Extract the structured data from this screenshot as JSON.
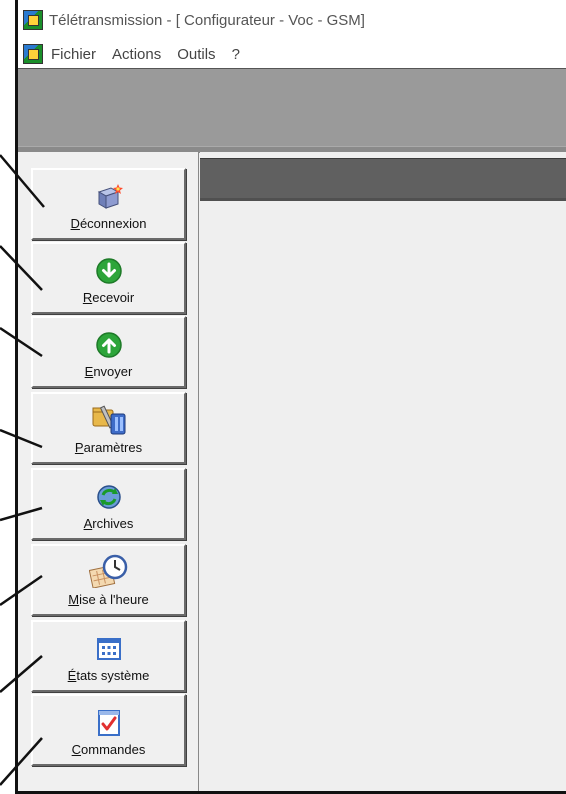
{
  "window": {
    "title": "Télétransmission - [ Configurateur - Voc - GSM]"
  },
  "menu": {
    "items": [
      "Fichier",
      "Actions",
      "Outils",
      "?"
    ]
  },
  "sidebar": {
    "buttons": [
      {
        "first": "D",
        "rest": "éconnexion",
        "icon": "disconnect-icon"
      },
      {
        "first": "R",
        "rest": "ecevoir",
        "icon": "download-arrow-icon"
      },
      {
        "first": "E",
        "rest": "nvoyer",
        "icon": "upload-arrow-icon"
      },
      {
        "first": "P",
        "rest": "aramètres",
        "icon": "settings-tools-icon"
      },
      {
        "first": "A",
        "rest": "rchives",
        "icon": "archive-refresh-icon"
      },
      {
        "first": "M",
        "rest": "ise à l'heure",
        "icon": "clock-calendar-icon"
      },
      {
        "first": "É",
        "rest": "tats système",
        "icon": "system-status-grid-icon"
      },
      {
        "first": "C",
        "rest": "ommandes",
        "icon": "checklist-icon"
      }
    ]
  },
  "colors": {
    "toolbar": "#9a9a9a",
    "header": "#606060",
    "green": "#2da53a"
  }
}
